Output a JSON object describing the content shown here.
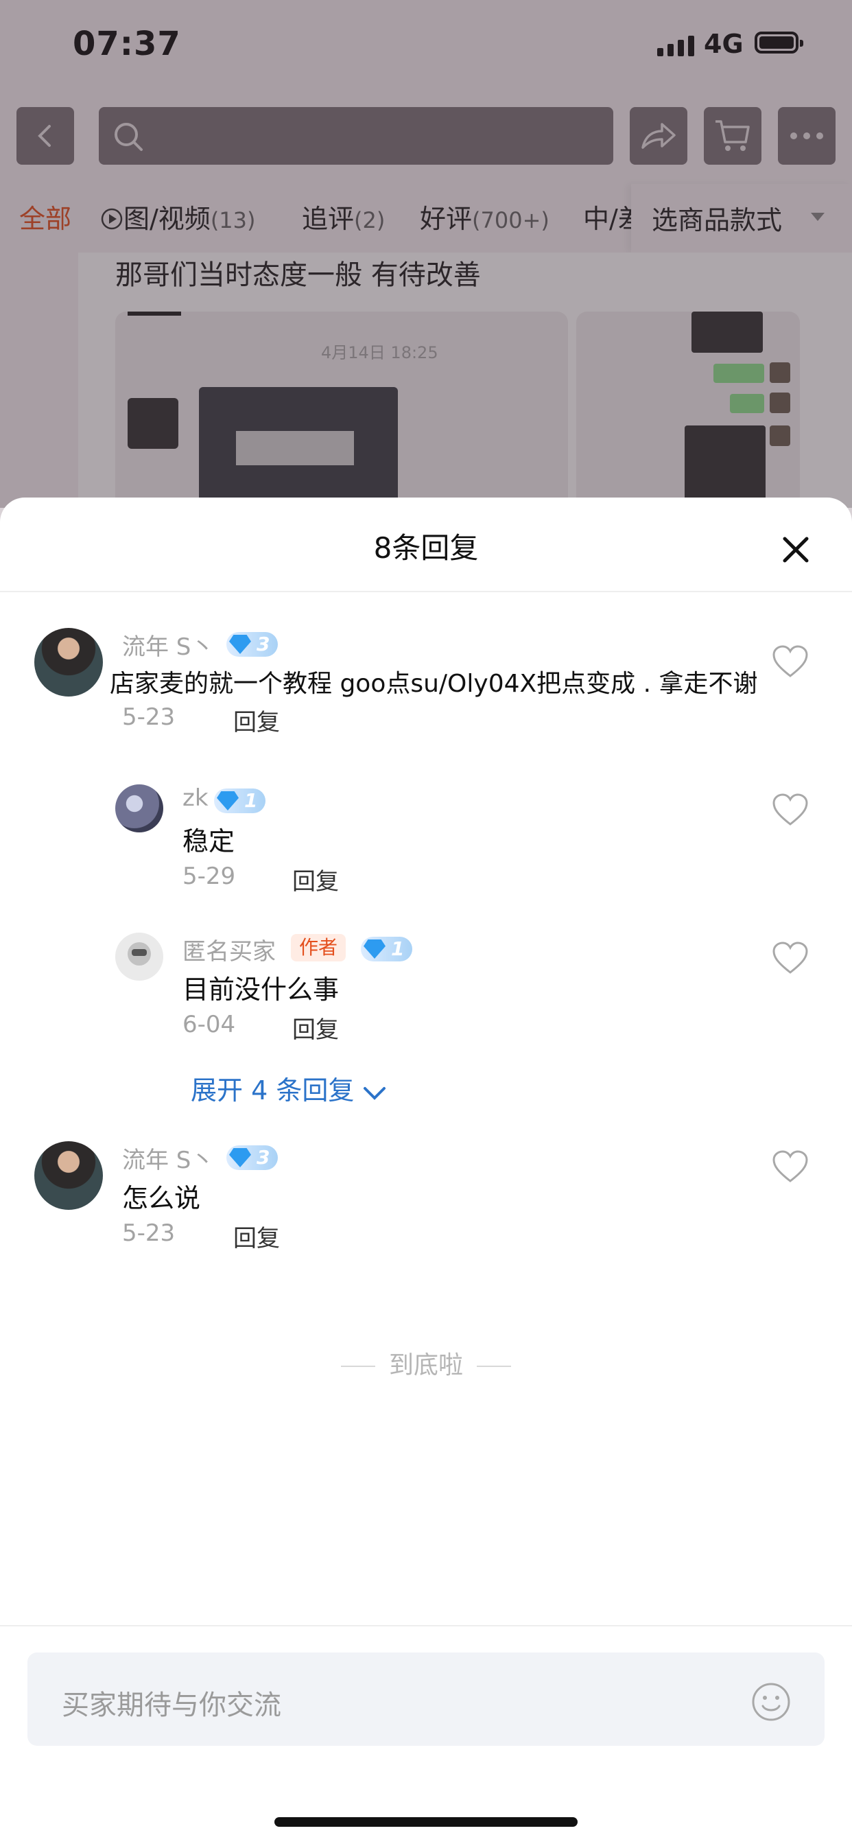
{
  "status": {
    "time": "07:37",
    "network": "4G"
  },
  "filters": [
    {
      "label": "全部",
      "count": ""
    },
    {
      "label": "图/视频",
      "count": "(13)"
    },
    {
      "label": "追评",
      "count": "(2)"
    },
    {
      "label": "好评",
      "count": "(700+)"
    },
    {
      "label": "中/差",
      "count": ""
    }
  ],
  "style_select": {
    "label": "选商品款式"
  },
  "background_review": {
    "text": "那哥们当时态度一般 有待改善",
    "image_date": "4月14日 18:25"
  },
  "sheet": {
    "title": "8条回复"
  },
  "comments": [
    {
      "name": "流年 S丶",
      "level": "3",
      "text": "店家麦的就一个教程 goo点su/Oly04X把点变成 . 拿走不谢",
      "date": "5-23",
      "reply": "回复"
    },
    {
      "name": "zk",
      "level": "1",
      "text": "稳定",
      "date": "5-29",
      "reply": "回复"
    },
    {
      "name": "匿名买家",
      "tag": "作者",
      "level": "1",
      "text": "目前没什么事",
      "date": "6-04",
      "reply": "回复"
    },
    {
      "name": "流年 S丶",
      "level": "3",
      "text": "怎么说",
      "date": "5-23",
      "reply": "回复"
    }
  ],
  "expand": {
    "label": "展开 4 条回复"
  },
  "end_text": "到底啦",
  "input": {
    "placeholder": "买家期待与你交流"
  },
  "icons": [
    "back-icon",
    "search-icon",
    "share-icon",
    "cart-icon",
    "more-icon",
    "play-icon",
    "close-icon",
    "heart-icon",
    "chevron-down-icon",
    "emoji-icon"
  ]
}
